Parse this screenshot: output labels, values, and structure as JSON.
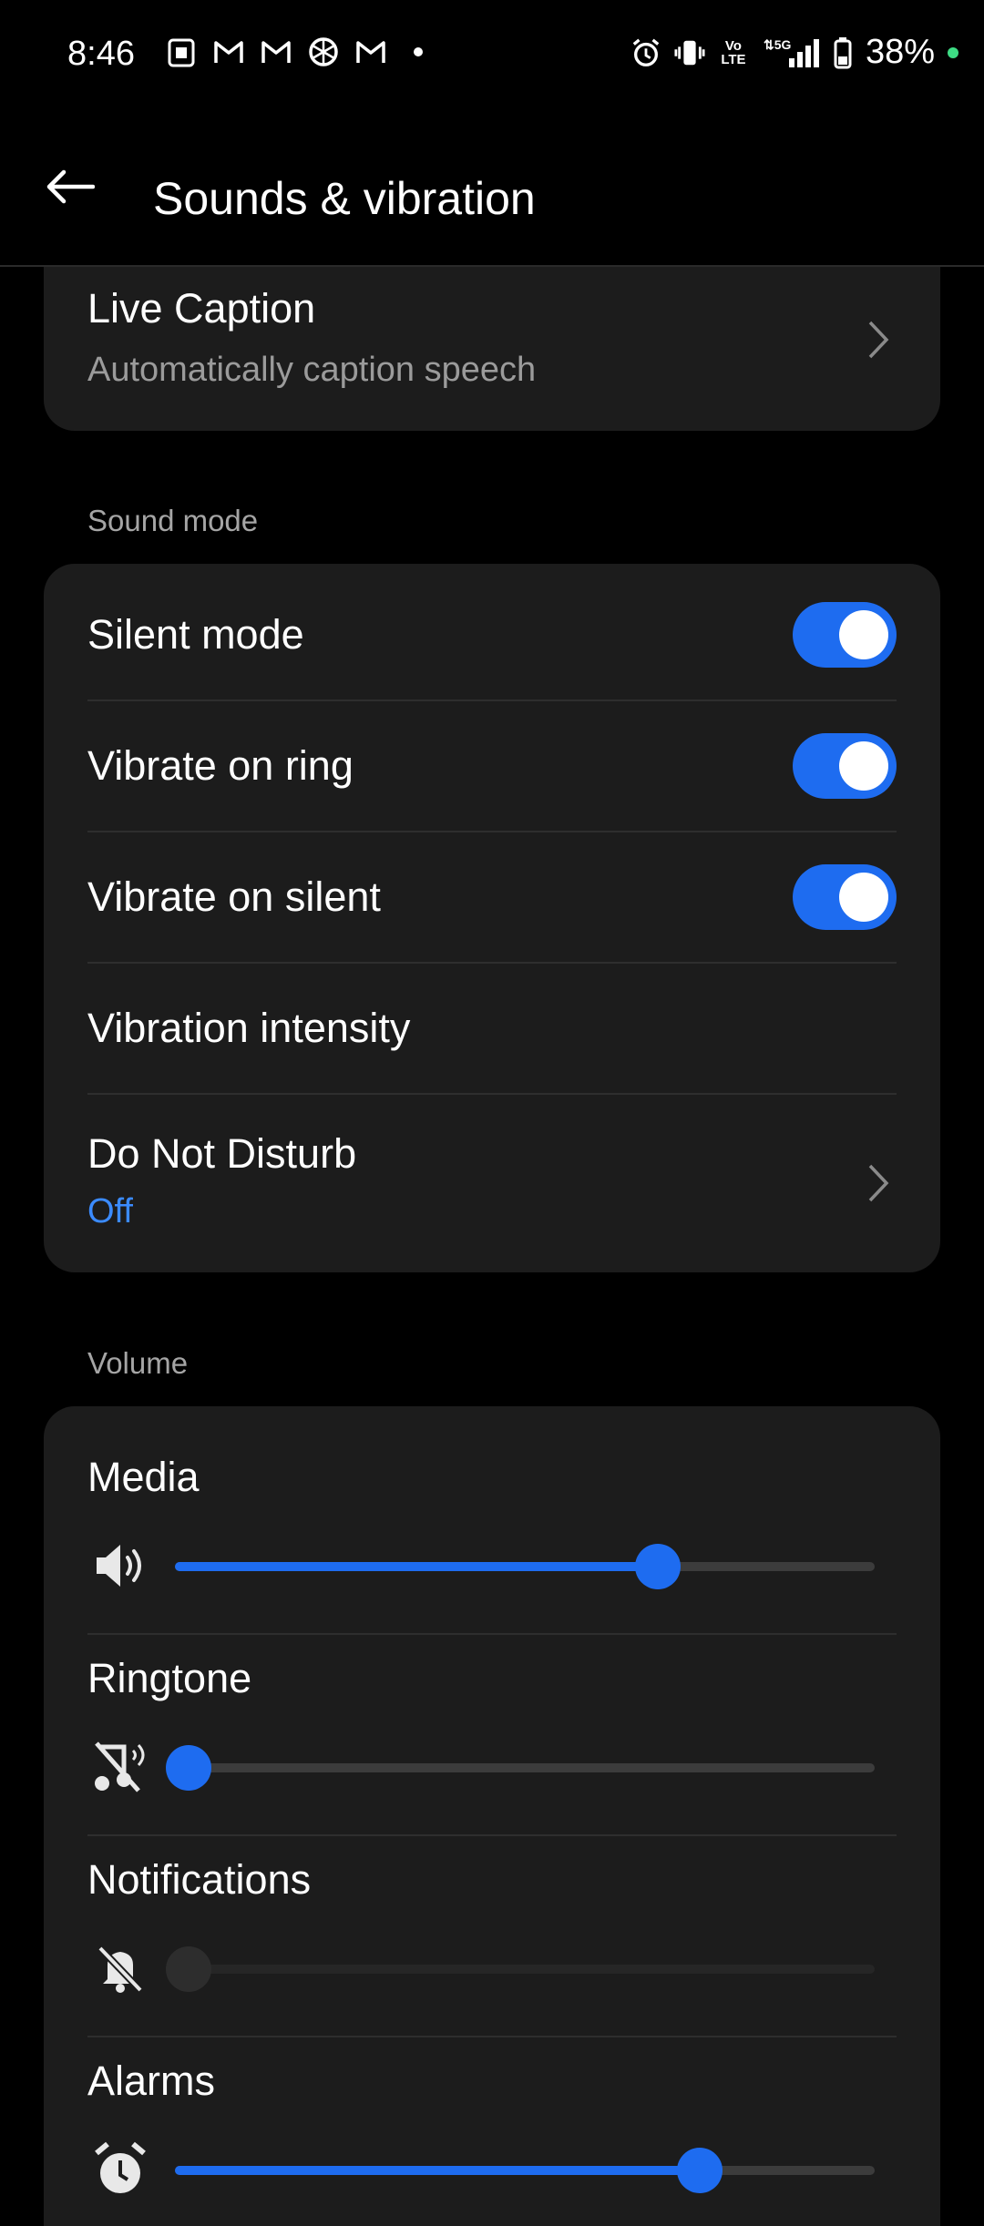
{
  "status_bar": {
    "time": "8:46",
    "left_icons": [
      "sim-tray-icon",
      "gmail-icon",
      "gmail-icon",
      "cloud-icon",
      "gmail-icon",
      "dot-icon"
    ],
    "right_icons": [
      "alarm-icon",
      "vibrate-icon",
      "volte-icon",
      "5g-signal-icon",
      "battery-icon"
    ],
    "network": "5G",
    "volte": "Vo LTE",
    "battery": "38%"
  },
  "header": {
    "title": "Sounds & vibration"
  },
  "live_caption": {
    "title": "Live Caption",
    "subtitle": "Automatically caption speech"
  },
  "sound_mode": {
    "section_label": "Sound mode",
    "rows": [
      {
        "label": "Silent mode",
        "on": true
      },
      {
        "label": "Vibrate on ring",
        "on": true
      },
      {
        "label": "Vibrate on silent",
        "on": true
      }
    ],
    "vibration_intensity": "Vibration intensity",
    "dnd": {
      "title": "Do Not Disturb",
      "value": "Off"
    }
  },
  "volume": {
    "section_label": "Volume",
    "sliders": [
      {
        "label": "Media",
        "icon": "speaker-icon",
        "level": 0.69,
        "enabled": true
      },
      {
        "label": "Ringtone",
        "icon": "ringtone-muted-icon",
        "level": 0.0,
        "enabled": true
      },
      {
        "label": "Notifications",
        "icon": "notification-muted-icon",
        "level": 0.0,
        "enabled": false
      },
      {
        "label": "Alarms",
        "icon": "alarm-icon",
        "level": 0.75,
        "enabled": true
      }
    ]
  },
  "colors": {
    "accent": "#1e6cf0",
    "card": "#1c1c1c",
    "background": "#000000",
    "link": "#3b8bff"
  }
}
